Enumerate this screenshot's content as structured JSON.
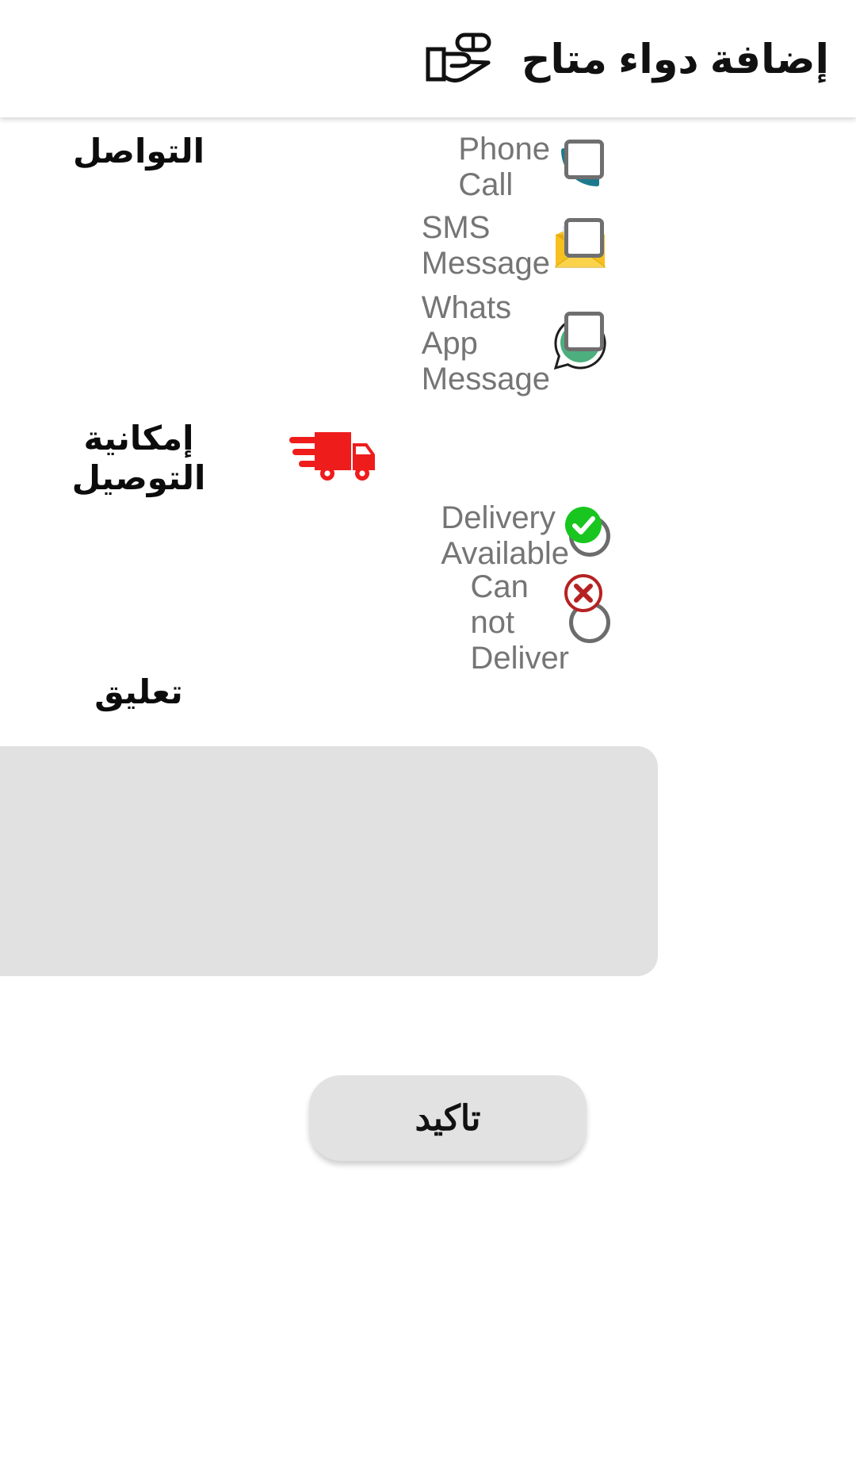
{
  "header": {
    "title": "إضافة دواء متاح",
    "icon": "hand-holding-pill-icon"
  },
  "contact_section": {
    "label": "التواصل",
    "options": [
      {
        "label": "Phone Call",
        "icon": "phone-icon",
        "checked": false,
        "color": "#1d7a8c"
      },
      {
        "label": "SMS Message",
        "icon": "sms-envelope-icon",
        "checked": false,
        "color": "#f2b713"
      },
      {
        "label": "Whats App Message",
        "icon": "whatsapp-icon",
        "checked": false,
        "color": "#4caf7d"
      }
    ]
  },
  "delivery_section": {
    "label": "إمكانية التوصيل",
    "icon": "delivery-truck-icon",
    "icon_color": "#ef1c1c",
    "options": [
      {
        "label": "Delivery Available",
        "selected": false,
        "status_icon": "check-circle-icon",
        "status_color": "#19c61f"
      },
      {
        "label": "Can not Deliver",
        "selected": false,
        "status_icon": "x-circle-icon",
        "status_color": "#b62222"
      }
    ]
  },
  "comment_section": {
    "label": "تعليق",
    "value": "",
    "placeholder": ""
  },
  "confirm_button": {
    "label": "تاكيد"
  },
  "colors": {
    "text_gray": "#757575",
    "text_dark": "#111111",
    "field_bg": "#e1e1e1",
    "border_gray": "#6f6f6f"
  }
}
